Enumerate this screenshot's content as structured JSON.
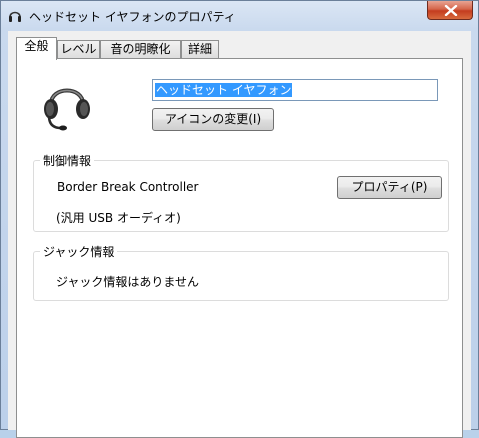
{
  "window": {
    "title": "ヘッドセット イヤフォンのプロパティ",
    "icon": "headset-icon",
    "close_icon": "close-icon"
  },
  "tabs": [
    {
      "label": "全般",
      "active": true
    },
    {
      "label": "レベル",
      "active": false
    },
    {
      "label": "音の明瞭化",
      "active": false
    },
    {
      "label": "詳細",
      "active": false
    }
  ],
  "general": {
    "device_name_value": "ヘッドセット イヤフォン",
    "change_icon_button": "アイコンの変更(I)",
    "controller_group": {
      "legend": "制御情報",
      "controller_name": "Border Break Controller",
      "properties_button": "プロパティ(P)",
      "driver_description": "(汎用 USB オーディオ)"
    },
    "jack_group": {
      "legend": "ジャック情報",
      "info_text": "ジャック情報はありません"
    }
  },
  "colors": {
    "selection": "#3399ff",
    "close_button": "#c43c1f",
    "panel_bg": "#f0f0f0"
  }
}
